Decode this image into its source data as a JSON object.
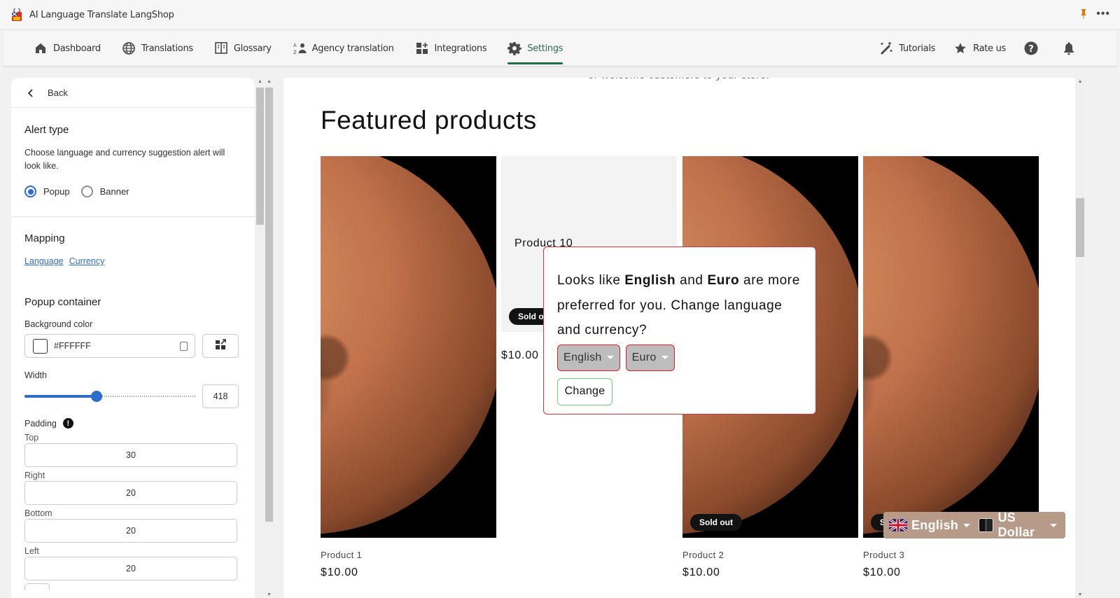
{
  "app": {
    "title": "AI Language Translate LangShop",
    "more_label": "•••"
  },
  "nav": {
    "left": [
      {
        "label": "Dashboard",
        "icon": "home-icon",
        "active": false
      },
      {
        "label": "Translations",
        "icon": "globe-icon",
        "active": false
      },
      {
        "label": "Glossary",
        "icon": "book-icon",
        "active": false
      },
      {
        "label": "Agency translation",
        "icon": "agency-icon",
        "active": false
      },
      {
        "label": "Integrations",
        "icon": "apps-icon",
        "active": false
      },
      {
        "label": "Settings",
        "icon": "gear-icon",
        "active": true
      }
    ],
    "right": [
      {
        "label": "Tutorials",
        "icon": "magic-wand-icon"
      },
      {
        "label": "Rate us",
        "icon": "star-icon"
      }
    ],
    "active_color": "#1f6e4a"
  },
  "panel": {
    "back_label": "Back",
    "alert_type": {
      "title": "Alert type",
      "description": "Choose language and currency suggestion alert will look like.",
      "options": [
        {
          "label": "Popup",
          "selected": true
        },
        {
          "label": "Banner",
          "selected": false
        }
      ]
    },
    "mapping": {
      "title": "Mapping",
      "links": [
        "Language",
        "Currency"
      ]
    },
    "popup_container": {
      "title": "Popup container",
      "background_color_label": "Background color",
      "background_color_value": "#FFFFFF",
      "width_label": "Width",
      "width_value": "418",
      "width_slider_fraction": 0.42,
      "padding_label": "Padding",
      "padding_info": "!",
      "padding": [
        {
          "label": "Top",
          "value": "30"
        },
        {
          "label": "Right",
          "value": "20"
        },
        {
          "label": "Bottom",
          "value": "20"
        },
        {
          "label": "Left",
          "value": "20"
        }
      ]
    },
    "accent_color": "#2c6ecb"
  },
  "preview": {
    "welcome_text": "or welcome customers to your store.",
    "section_title": "Featured products",
    "products": [
      {
        "name": "Product 1",
        "price": "$10.00",
        "sold_out": false,
        "image": "mars"
      },
      {
        "name": "Product 10",
        "price": "$10.00",
        "sold_out": true,
        "sold_label": "Sold out",
        "image": "placeholder"
      },
      {
        "name": "Product 2",
        "price": "$10.00",
        "sold_out": true,
        "sold_label": "Sold out",
        "image": "mars"
      },
      {
        "name": "Product 3",
        "price": "$10.00",
        "sold_out": true,
        "sold_label": "Sold out",
        "image": "mars"
      }
    ],
    "popup": {
      "msg_prefix": "Looks like ",
      "language": "English",
      "msg_and": " and ",
      "currency": "Euro",
      "msg_suffix": " are more preferred for you. Change language and currency?",
      "language_select": "English",
      "currency_select": "Euro",
      "change_button": "Change",
      "border_color": "#e0303a",
      "button_border_color": "#6fd07b"
    },
    "switcher": {
      "language": "English",
      "currency": "US Dollar",
      "background": "#b89a89"
    }
  }
}
